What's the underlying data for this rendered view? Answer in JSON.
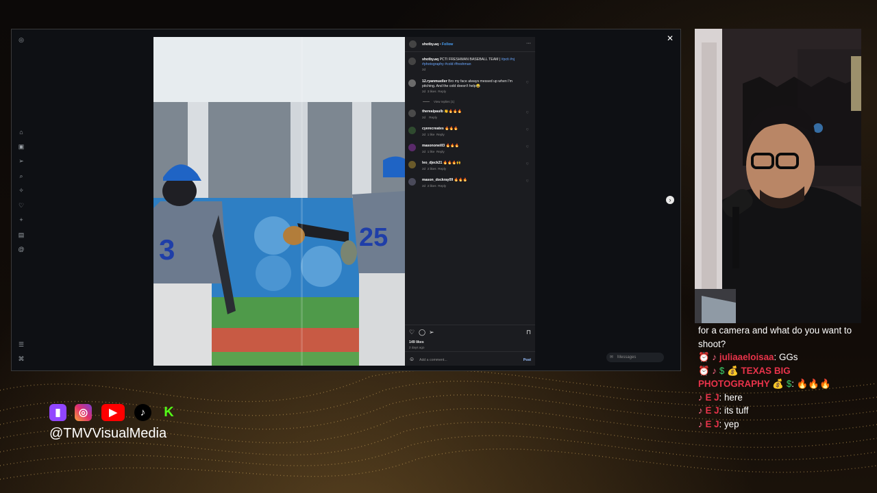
{
  "post": {
    "author": "shotby.aq",
    "follow_label": "Follow",
    "more": "···",
    "caption_user": "shotby.aq",
    "caption_text": "PCTI FRESHMAN BASEBALL TEAM |",
    "caption_tags": "#pcti #nj #photography #cold #freshman",
    "caption_tags_line1": "#pcti #nj",
    "caption_tags_line2": "#photography #cold #freshman",
    "caption_age": "2d",
    "likes": "149 likes",
    "date": "2 days ago",
    "add_comment": "Add a comment...",
    "post_label": "Post",
    "view_replies": "View replies (1)",
    "jersey_left": "3",
    "jersey_right": "25",
    "comments": [
      {
        "user": "12.ryanmueller",
        "text": "Bro my face always messed up when I'm pitching. And the cold doesn't help😂",
        "age": "2d",
        "likes": "3 likes",
        "reply": "Reply"
      },
      {
        "user": "therealpaulb",
        "text": "👏🔥🔥🔥",
        "age": "2d",
        "likes": "",
        "reply": "Reply"
      },
      {
        "user": "cyerecreates",
        "text": "🔥🔥🔥",
        "age": "2d",
        "likes": "1 like",
        "reply": "Reply"
      },
      {
        "user": "masononeill3",
        "text": "🔥🔥🔥",
        "age": "2d",
        "likes": "1 like",
        "reply": "Reply"
      },
      {
        "user": "leo_djeck21",
        "text": "🔥🔥🔥🙌",
        "age": "2d",
        "likes": "2 likes",
        "reply": "Reply"
      },
      {
        "user": "mason_dockray09",
        "text": "🔥🔥🔥",
        "age": "2d",
        "likes": "2 likes",
        "reply": "Reply"
      }
    ]
  },
  "browser": {
    "messages_label": "Messages",
    "close_icon": "close-icon",
    "next_icon": "chevron-right-icon"
  },
  "chat": {
    "line1": "for a camera and what do you want to shoot?",
    "messages": [
      {
        "user": "juliaaeloisaa",
        "text": ": GGs"
      },
      {
        "user": "TEXAS BIG PHOTOGRAPHY",
        "user_prefix": "💰",
        "user_suffix": "💰",
        "prefix_icons": "$",
        "suffix_icons": "$",
        "text": ": 🔥🔥🔥"
      },
      {
        "user": "E J",
        "text": ": here"
      },
      {
        "user": "E J",
        "text": ": its tuff"
      },
      {
        "user": "E J",
        "text": ": yep"
      }
    ]
  },
  "social": {
    "handle": "@TMVVisualMedia",
    "icons": [
      "twitch-icon",
      "instagram-icon",
      "youtube-icon",
      "tiktok-icon",
      "kick-icon"
    ]
  }
}
